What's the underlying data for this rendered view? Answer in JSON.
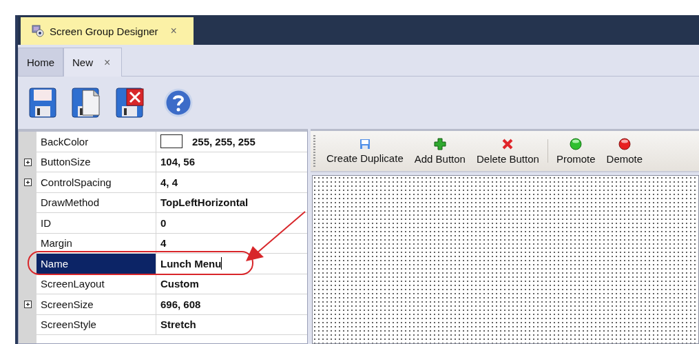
{
  "document_tab": {
    "title": "Screen Group Designer",
    "close": "×"
  },
  "tabs": [
    {
      "label": "Home",
      "selected": false
    },
    {
      "label": "New",
      "selected": true,
      "close": "×"
    }
  ],
  "properties": [
    {
      "name": "BackColor",
      "value": "255, 255, 255",
      "expandable": false,
      "selected": false,
      "color": "#ffffff"
    },
    {
      "name": "ButtonSize",
      "value": "104, 56",
      "expandable": true,
      "selected": false
    },
    {
      "name": "ControlSpacing",
      "value": "4, 4",
      "expandable": true,
      "selected": false
    },
    {
      "name": "DrawMethod",
      "value": "TopLeftHorizontal",
      "expandable": false,
      "selected": false
    },
    {
      "name": "ID",
      "value": "0",
      "expandable": false,
      "selected": false
    },
    {
      "name": "Margin",
      "value": "4",
      "expandable": false,
      "selected": false
    },
    {
      "name": "Name",
      "value": "Lunch Menu",
      "expandable": false,
      "selected": true,
      "editing": true,
      "circled": true
    },
    {
      "name": "ScreenLayout",
      "value": "Custom",
      "expandable": false,
      "selected": false
    },
    {
      "name": "ScreenSize",
      "value": "696, 608",
      "expandable": true,
      "selected": false
    },
    {
      "name": "ScreenStyle",
      "value": "Stretch",
      "expandable": false,
      "selected": false
    }
  ],
  "designer_toolbar": {
    "groups": [
      [
        {
          "label": "Create Duplicate",
          "kind": "duplicate"
        },
        {
          "label": "Add Button",
          "kind": "add"
        },
        {
          "label": "Delete Button",
          "kind": "delete"
        }
      ],
      [
        {
          "label": "Promote",
          "kind": "promote"
        },
        {
          "label": "Demote",
          "kind": "demote"
        }
      ]
    ]
  }
}
